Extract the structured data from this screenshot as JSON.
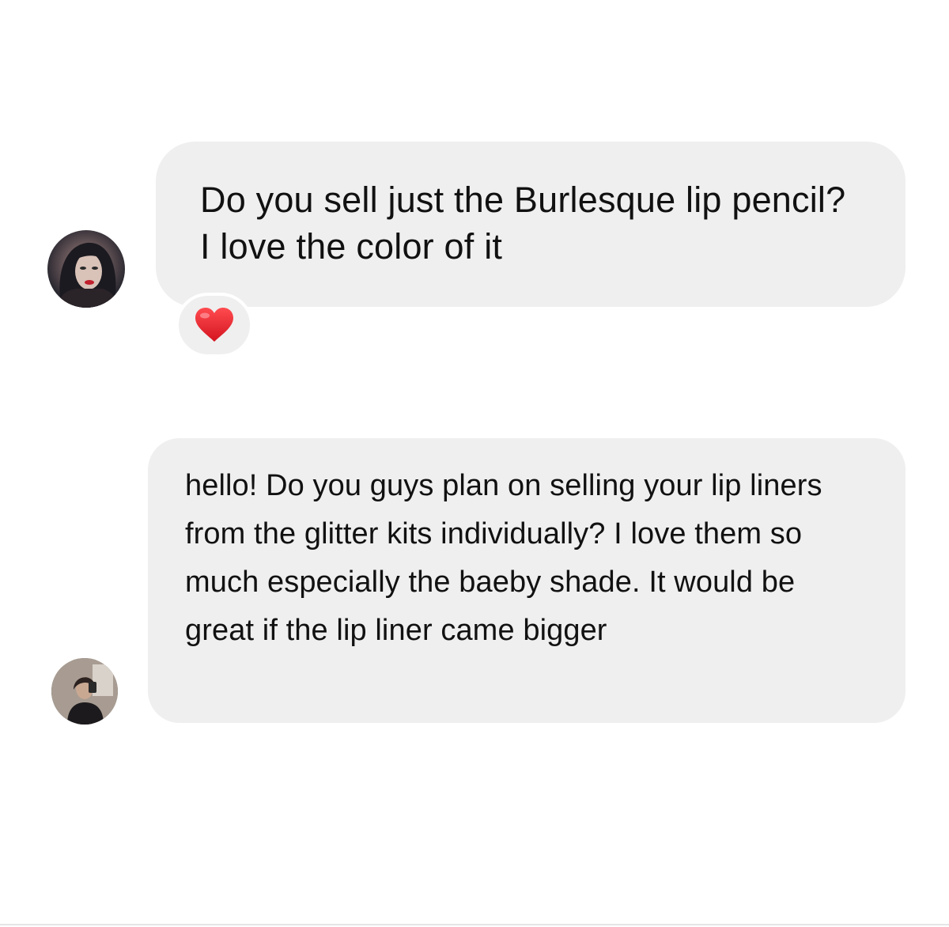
{
  "conversation": {
    "messages": [
      {
        "text": "Do you sell just the Burlesque lip pencil? I love the color of it",
        "avatar_icon": "profile-photo-woman-red-lips",
        "reaction_icon": "red-heart"
      },
      {
        "text": "hello! Do you guys plan on selling your lip liners from the glitter kits individually? I love them so much especially the baeby shade. It would be great if the lip liner came bigger",
        "avatar_icon": "profile-photo-mirror-selfie"
      }
    ]
  },
  "colors": {
    "bubble": "#efefef",
    "text": "#111111",
    "heart": "#e8232e",
    "background": "#ffffff"
  }
}
